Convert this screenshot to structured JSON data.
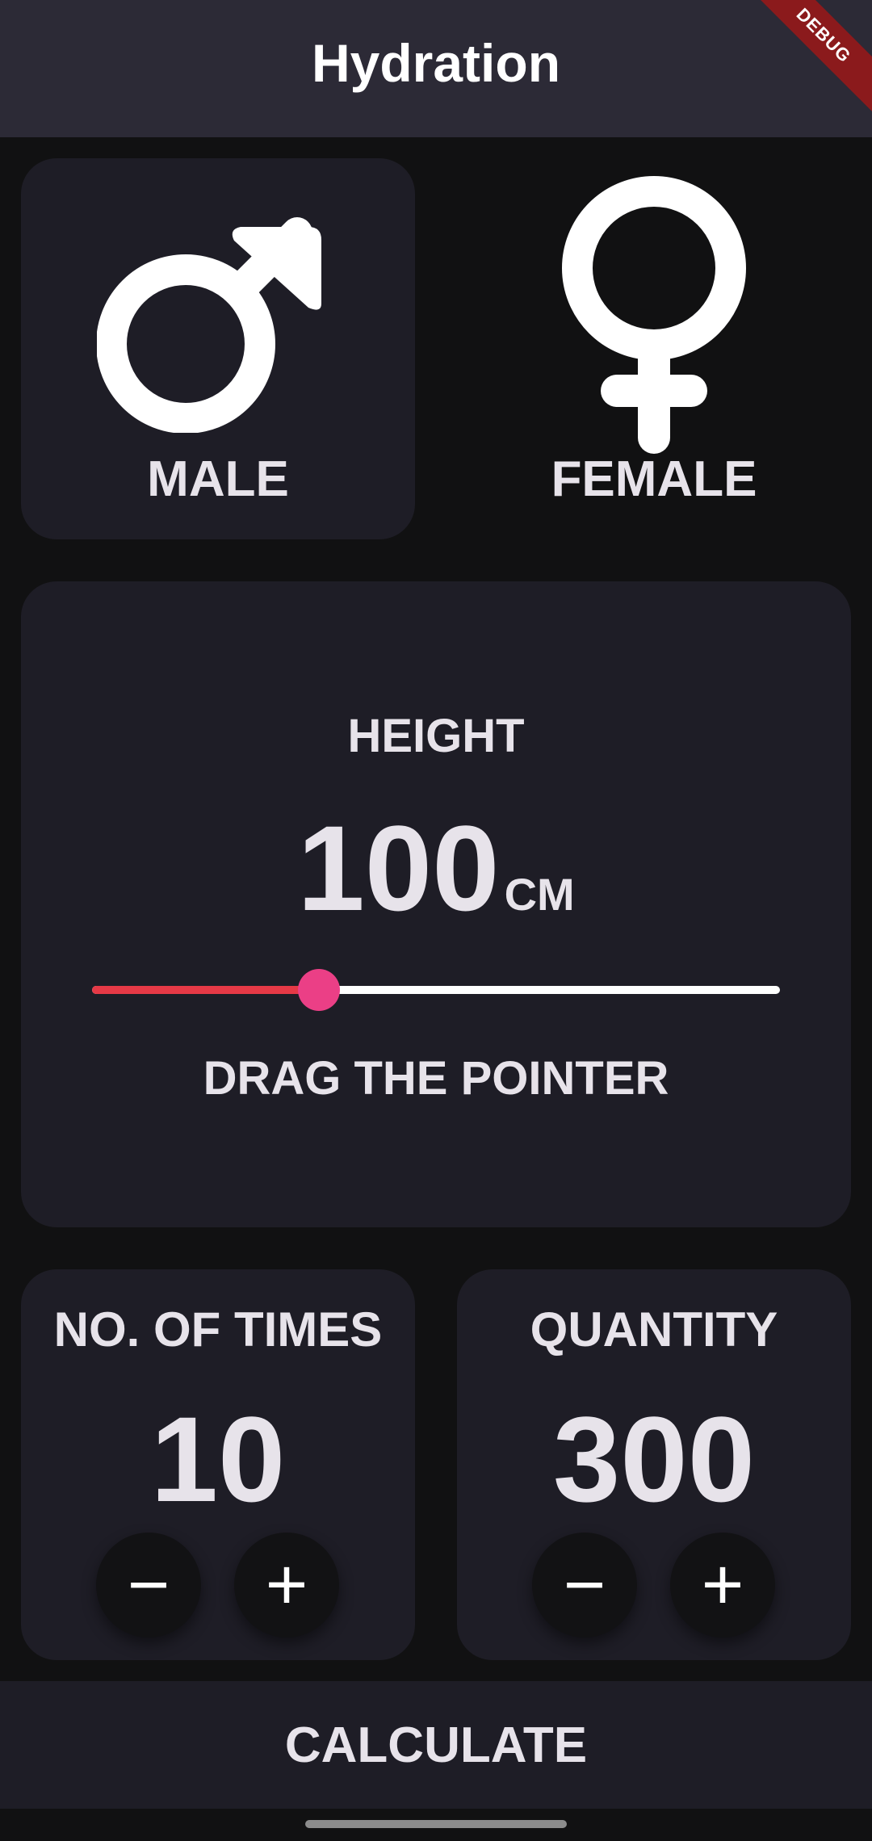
{
  "app_bar": {
    "title": "Hydration",
    "debug_banner": "DEBUG"
  },
  "gender": {
    "male": {
      "label": "MALE",
      "icon": "male-symbol-icon",
      "selected": true
    },
    "female": {
      "label": "FEMALE",
      "icon": "female-symbol-icon",
      "selected": false
    }
  },
  "height": {
    "label": "HEIGHT",
    "value": "100",
    "unit": "CM",
    "hint": "DRAG THE POINTER",
    "slider_fraction": 0.33
  },
  "times": {
    "label": "NO. OF TIMES",
    "value": "10",
    "minus": "−",
    "plus": "+"
  },
  "quantity": {
    "label": "QUANTITY",
    "value": "300",
    "minus": "−",
    "plus": "+"
  },
  "calculate": {
    "label": "CALCULATE"
  },
  "colors": {
    "app_bar": "#2c2a36",
    "card": "#1e1d26",
    "background": "#111112",
    "slider_active": "#e63946",
    "slider_thumb": "#eb3f86",
    "text": "#e7e3ea"
  }
}
